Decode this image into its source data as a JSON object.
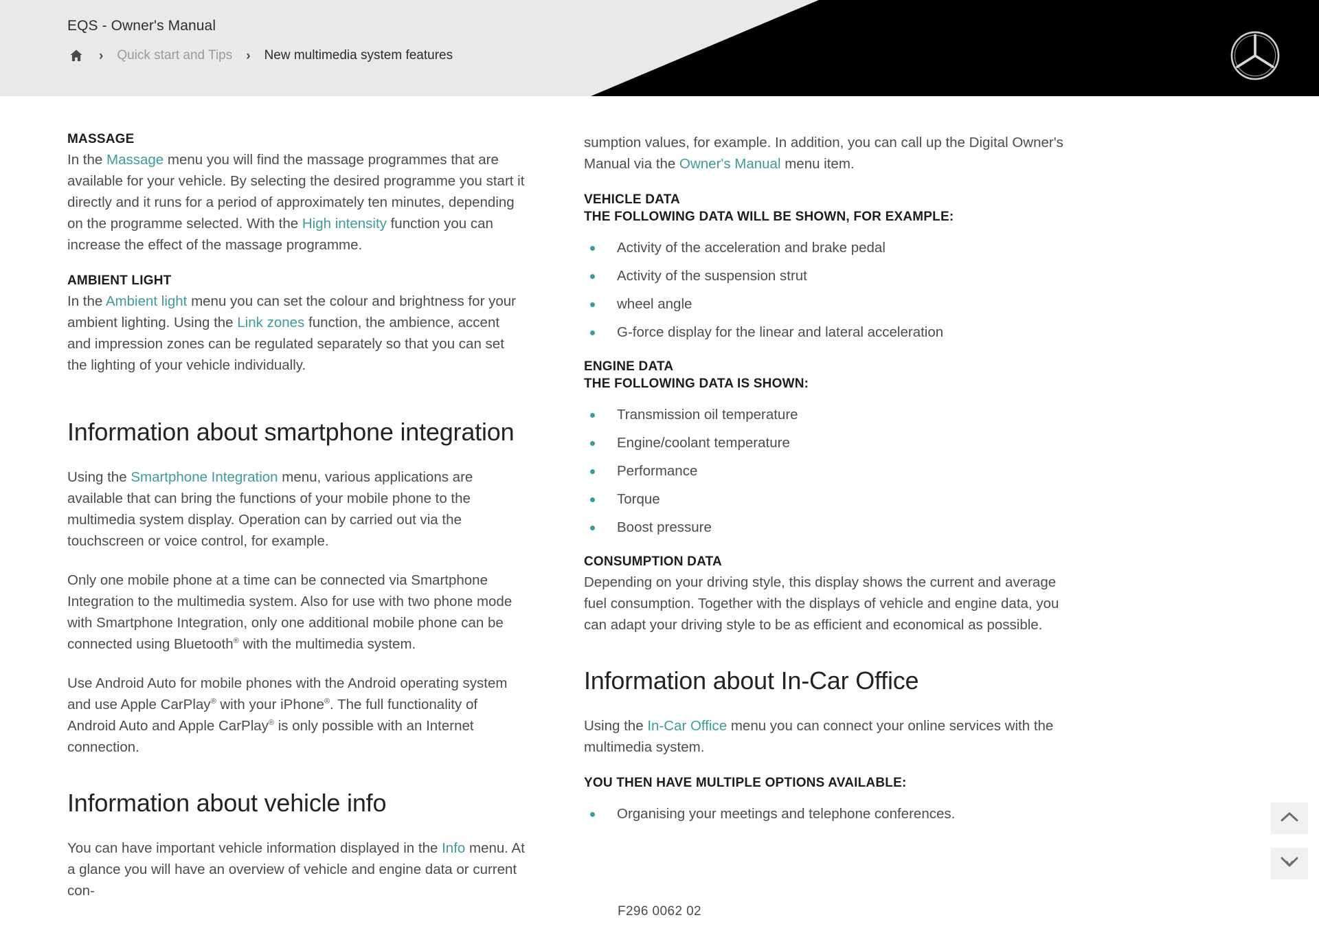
{
  "header": {
    "manual_title": "EQS - Owner's Manual",
    "home_icon": "home-icon",
    "separator": "›",
    "breadcrumb": [
      {
        "label": "Quick start and Tips",
        "current": false
      },
      {
        "label": "New multimedia system features",
        "current": true
      }
    ],
    "logo": "mercedes-benz-star-logo",
    "accent_color": "#3e9a9c",
    "header_bg": "#e9e9e9",
    "header_black": "#000000"
  },
  "left_column": {
    "massage": {
      "heading": "MASSAGE",
      "text_1": "In the ",
      "link_1": "Massage",
      "text_2": " menu you will find the massage programmes that are available for your vehicle. By selecting the desired programme you start it directly and it runs for a period of approximately ten minutes, depending on the programme selected. With the ",
      "link_2": "High intensity",
      "text_3": " function you can increase the effect of the massage programme."
    },
    "ambient_light": {
      "heading": "AMBIENT LIGHT",
      "text_1": "In the ",
      "link_1": "Ambient light",
      "text_2": " menu you can set the colour and brightness for your ambient lighting. Using the ",
      "link_2": "Link zones",
      "text_3": " function, the ambience, accent and impression zones can be regulated separately so that you can set the lighting of your vehicle individually."
    },
    "smartphone": {
      "heading": "Information about smartphone integration",
      "p1_text_1": "Using the ",
      "p1_link": "Smartphone Integration",
      "p1_text_2": " menu, various applications are available that can bring the functions of your mobile phone to the multimedia system display. Operation can by carried out via the touchscreen or voice control, for example.",
      "p2_text_1": "Only one mobile phone at a time can be connected via Smartphone Integration to the multimedia system. Also for use with two phone mode with Smartphone Integration, only one additional mobile phone can be connected using Bluetooth",
      "p2_reg": "®",
      "p2_text_2": " with the multimedia system.",
      "p3_text_1": "Use Android Auto for mobile phones with the Android operating system and use Apple CarPlay",
      "p3_reg_1": "®",
      "p3_text_2": " with your iPhone",
      "p3_reg_2": "®",
      "p3_text_3": ". The full functionality of Android Auto and Apple CarPlay",
      "p3_reg_3": "®",
      "p3_text_4": " is only possible with an Internet connection."
    },
    "vehicle_info": {
      "heading": "Information about vehicle info",
      "p1_text_1": "You can have important vehicle information displayed in the ",
      "p1_link": "Info",
      "p1_text_2": " menu. At a glance you will have an overview of vehicle and engine data or current con-"
    }
  },
  "right_column": {
    "continuation": {
      "text_1": "sumption values, for example. In addition, you can call up the Digital Owner's Manual via the ",
      "link_1": "Owner's Manual",
      "text_2": " menu item."
    },
    "vehicle_data": {
      "heading": "VEHICLE DATA",
      "subheading": "THE FOLLOWING DATA WILL BE SHOWN, FOR EXAMPLE:",
      "items": [
        "Activity of the acceleration and brake pedal",
        "Activity of the suspension strut",
        "wheel angle",
        "G-force display for the linear and lateral acceleration"
      ]
    },
    "engine_data": {
      "heading": "ENGINE DATA",
      "subheading": "THE FOLLOWING DATA IS SHOWN:",
      "items": [
        "Transmission oil temperature",
        "Engine/coolant temperature",
        "Performance",
        "Torque",
        "Boost pressure"
      ]
    },
    "consumption_data": {
      "heading": "CONSUMPTION DATA",
      "text": "Depending on your driving style, this display shows the current and average fuel consumption. Together with the displays of vehicle and engine data, you can adapt your driving style to be as efficient and economical as possible."
    },
    "in_car_office": {
      "heading": "Information about In-Car Office",
      "p1_text_1": "Using the ",
      "p1_link": "In-Car Office",
      "p1_text_2": " menu you can connect your online services with the multimedia system.",
      "subheading": "YOU THEN HAVE MULTIPLE OPTIONS AVAILABLE:",
      "items": [
        "Organising your meetings and telephone conferences."
      ]
    }
  },
  "floating_buttons": [
    {
      "name": "scroll-up-button",
      "icon": "chevron-up-icon"
    },
    {
      "name": "scroll-down-button",
      "icon": "chevron-down-icon"
    }
  ],
  "footer": {
    "document_code": "F296 0062 02"
  }
}
